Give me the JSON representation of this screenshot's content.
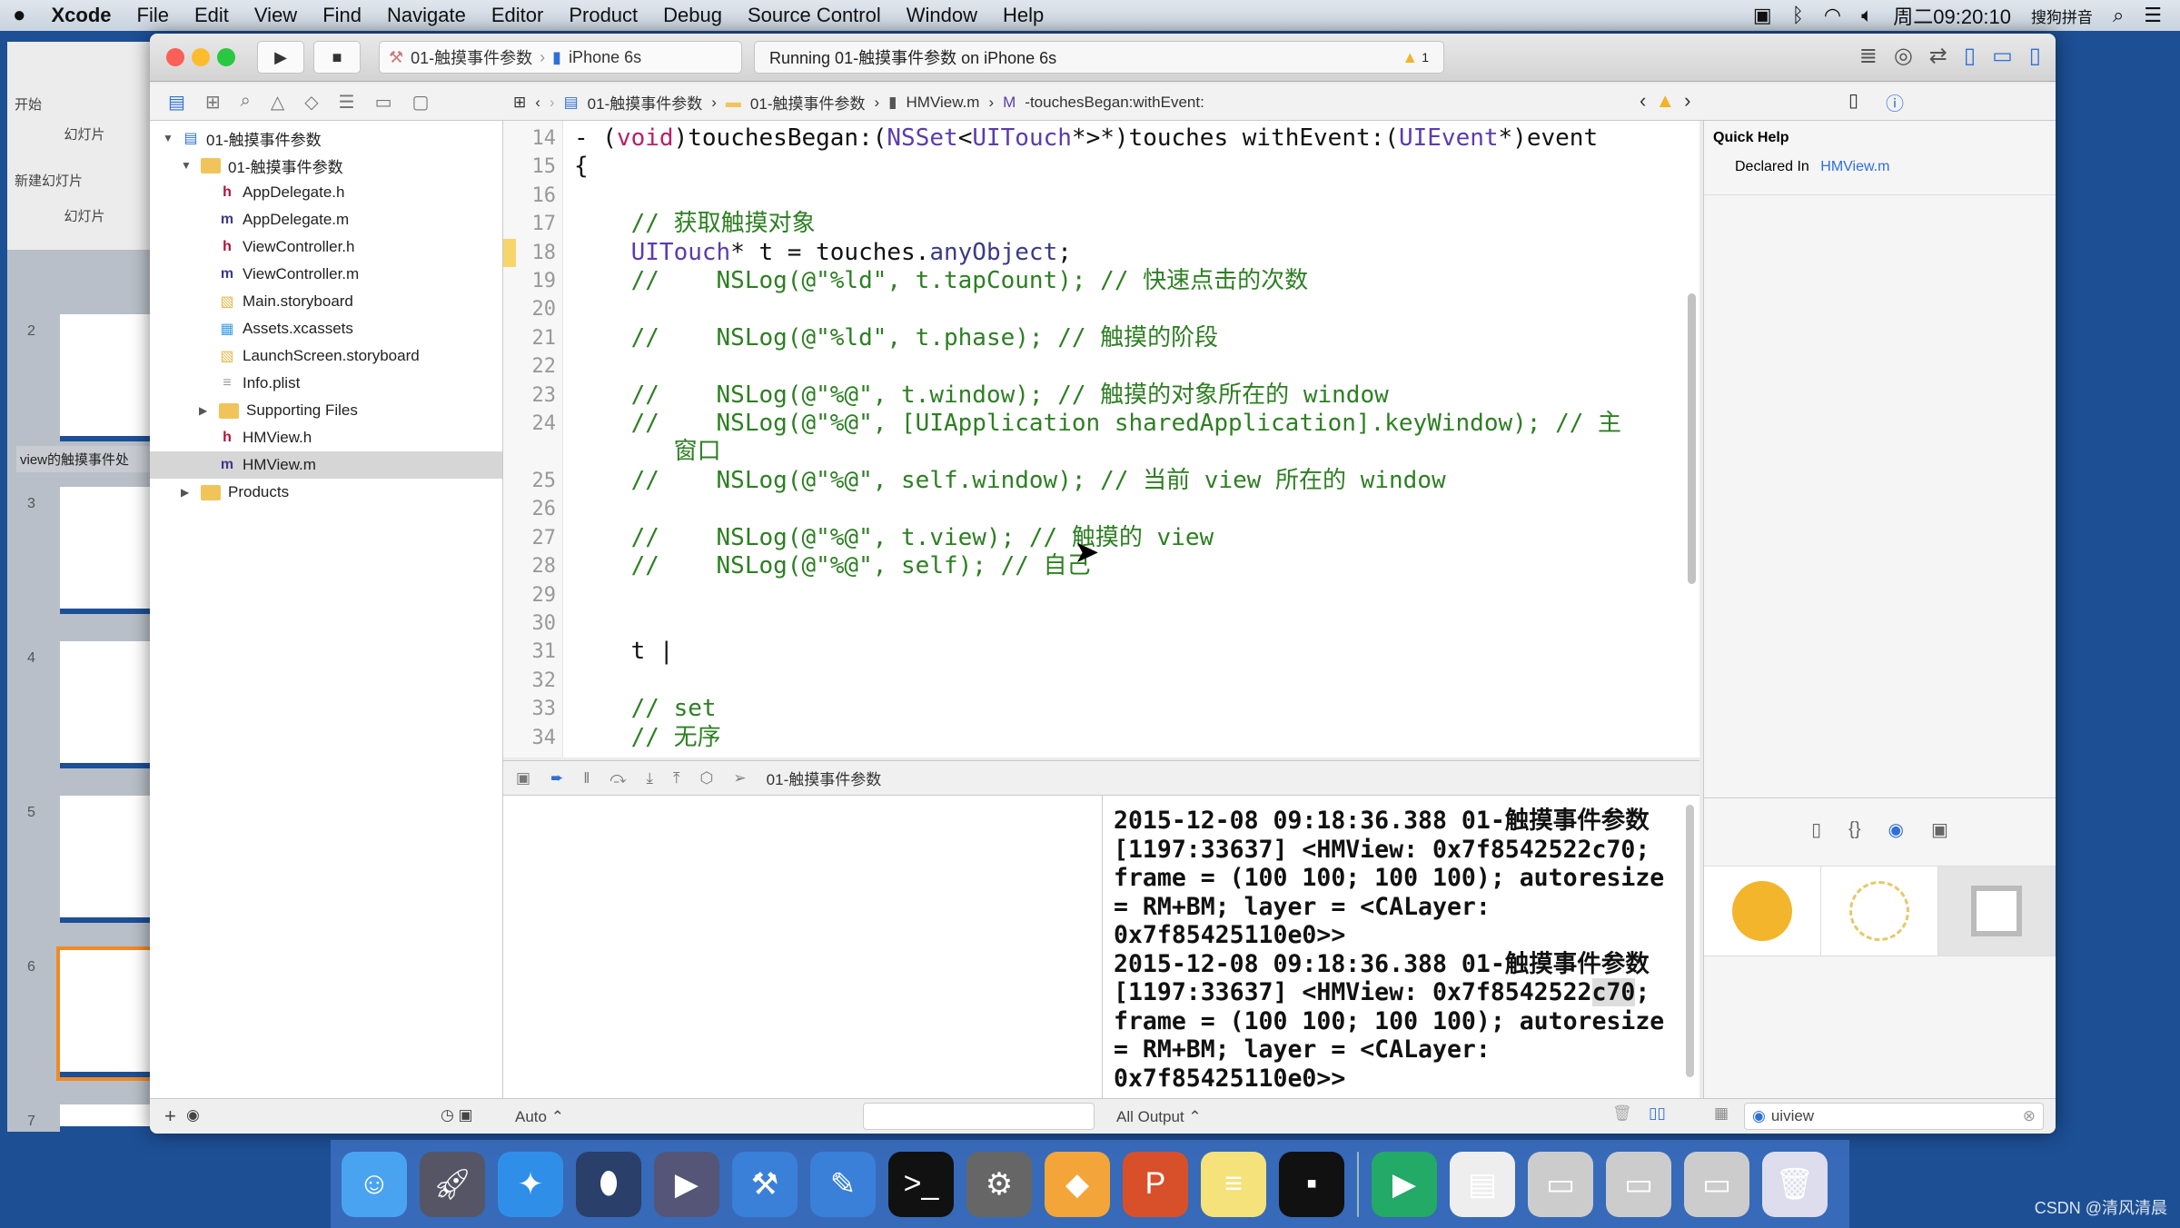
{
  "menubar": {
    "apple": "",
    "items": [
      "Xcode",
      "File",
      "Edit",
      "View",
      "Find",
      "Navigate",
      "Editor",
      "Product",
      "Debug",
      "Source Control",
      "Window",
      "Help"
    ],
    "clock": "周二09:20:10",
    "ime": "搜狗拼音"
  },
  "background_app": {
    "tab_home": "开始",
    "group": "幻灯片",
    "new_slide": "新建幻灯片",
    "pane_label": "幻灯片",
    "section": "view的触摸事件处",
    "slide_numbers": [
      "2",
      "3",
      "4",
      "5",
      "6",
      "7"
    ]
  },
  "toolbar": {
    "scheme": "01-触摸事件参数",
    "device": "iPhone 6s",
    "status": "Running 01-触摸事件参数 on iPhone 6s",
    "warnings": "1"
  },
  "jumpbar": {
    "items": [
      "01-触摸事件参数",
      "01-触摸事件参数",
      "HMView.m",
      "-touchesBegan:withEvent:"
    ]
  },
  "navigator": {
    "items": [
      {
        "label": "01-触摸事件参数",
        "kind": "project",
        "depth": 0,
        "open": true
      },
      {
        "label": "01-触摸事件参数",
        "kind": "folder",
        "depth": 1,
        "open": true
      },
      {
        "label": "AppDelegate.h",
        "kind": "h",
        "depth": 2
      },
      {
        "label": "AppDelegate.m",
        "kind": "m",
        "depth": 2
      },
      {
        "label": "ViewController.h",
        "kind": "h",
        "depth": 2
      },
      {
        "label": "ViewController.m",
        "kind": "m",
        "depth": 2
      },
      {
        "label": "Main.storyboard",
        "kind": "storyboard",
        "depth": 2
      },
      {
        "label": "Assets.xcassets",
        "kind": "assets",
        "depth": 2
      },
      {
        "label": "LaunchScreen.storyboard",
        "kind": "storyboard",
        "depth": 2
      },
      {
        "label": "Info.plist",
        "kind": "plist",
        "depth": 2
      },
      {
        "label": "Supporting Files",
        "kind": "folder",
        "depth": 2,
        "open": false
      },
      {
        "label": "HMView.h",
        "kind": "h",
        "depth": 2
      },
      {
        "label": "HMView.m",
        "kind": "m",
        "depth": 2,
        "selected": true
      },
      {
        "label": "Products",
        "kind": "folder",
        "depth": 1,
        "open": false
      }
    ]
  },
  "editor": {
    "lines": [
      {
        "n": "14",
        "s": [
          [
            "tx",
            "- ("
          ],
          [
            "k",
            "void"
          ],
          [
            "tx",
            ")touchesBegan:("
          ],
          [
            "ty",
            "NSSet"
          ],
          [
            "tx",
            "<"
          ],
          [
            "ty",
            "UITouch"
          ],
          [
            "tx",
            "*>*)touches withEvent:("
          ],
          [
            "ty",
            "UIEvent"
          ],
          [
            "tx",
            "*)event"
          ]
        ]
      },
      {
        "n": "15",
        "s": [
          [
            "tx",
            "{"
          ]
        ]
      },
      {
        "n": "16",
        "s": []
      },
      {
        "n": "17",
        "s": [
          [
            "cm",
            "    // 获取触摸对象"
          ]
        ]
      },
      {
        "n": "18",
        "warn": true,
        "s": [
          [
            "ty",
            "    UITouch"
          ],
          [
            "tx",
            "* t = touches."
          ],
          [
            "me",
            "anyObject"
          ],
          [
            "tx",
            ";"
          ]
        ]
      },
      {
        "n": "19",
        "s": [
          [
            "cm",
            "    //    NSLog(@\"%ld\", t.tapCount); // 快速点击的次数"
          ]
        ]
      },
      {
        "n": "20",
        "s": []
      },
      {
        "n": "21",
        "s": [
          [
            "cm",
            "    //    NSLog(@\"%ld\", t.phase); // 触摸的阶段"
          ]
        ]
      },
      {
        "n": "22",
        "s": []
      },
      {
        "n": "23",
        "s": [
          [
            "cm",
            "    //    NSLog(@\"%@\", t.window); // 触摸的对象所在的 window"
          ]
        ]
      },
      {
        "n": "24",
        "s": [
          [
            "cm",
            "    //    NSLog(@\"%@\", [UIApplication sharedApplication].keyWindow); // 主"
          ]
        ]
      },
      {
        "n": "",
        "s": [
          [
            "cm",
            "       窗口"
          ]
        ]
      },
      {
        "n": "25",
        "s": [
          [
            "cm",
            "    //    NSLog(@\"%@\", self.window); // 当前 view 所在的 window"
          ]
        ]
      },
      {
        "n": "26",
        "s": []
      },
      {
        "n": "27",
        "s": [
          [
            "cm",
            "    //    NSLog(@\"%@\", t.view); // 触摸的 view"
          ]
        ]
      },
      {
        "n": "28",
        "s": [
          [
            "cm",
            "    //    NSLog(@\"%@\", self); // 自己"
          ]
        ]
      },
      {
        "n": "29",
        "s": []
      },
      {
        "n": "30",
        "s": []
      },
      {
        "n": "31",
        "s": [
          [
            "tx",
            "    t |"
          ]
        ]
      },
      {
        "n": "32",
        "s": []
      },
      {
        "n": "33",
        "s": [
          [
            "cm",
            "    // set"
          ]
        ]
      },
      {
        "n": "34",
        "s": [
          [
            "cm",
            "    // 无序"
          ]
        ]
      }
    ]
  },
  "debugbar": {
    "target": "01-触摸事件参数"
  },
  "console": {
    "entries": [
      "2015-12-08 09:18:36.388 01-触摸事件参数 [1197:33637] <HMView: 0x7f8542522c70; frame = (100 100; 100 100); autoresize = RM+BM; layer = <CALayer: 0x7f85425110e0>>",
      "2015-12-08 09:18:36.388 01-触摸事件参数 [1197:33637] <HMView: 0x7f8542522c70; frame = (100 100; 100 100); autoresize = RM+BM; layer = <CALayer: 0x7f85425110e0>>"
    ]
  },
  "bottombar": {
    "auto": "Auto ⌃",
    "output": "All Output ⌃",
    "filter_value": "uiview"
  },
  "inspector": {
    "title": "Quick Help",
    "declared_label": "Declared In",
    "declared_file": "HMView.m"
  },
  "watermark": "CSDN @清风清晨",
  "colors": {
    "accent": "#2f6fd8",
    "warning": "#f0b429",
    "keyword": "#b5206b",
    "type": "#5b3bb0",
    "comment": "#2d7f22"
  }
}
